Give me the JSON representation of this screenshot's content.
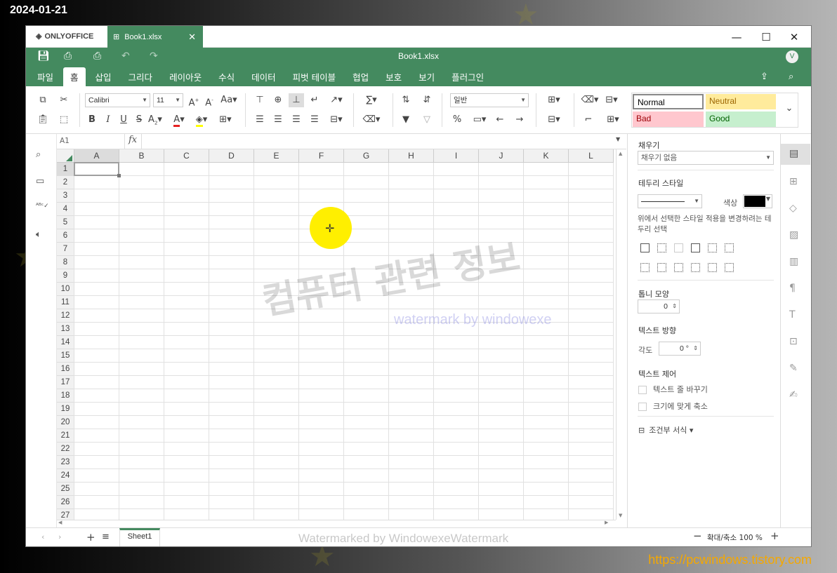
{
  "overlay": {
    "date": "2024-01-21",
    "site": "https://pcwindows.tistory.com"
  },
  "window": {
    "brand": "ONLYOFFICE",
    "tab_label": "Book1.xlsx",
    "title": "Book1.xlsx",
    "user_initial": "V",
    "controls": {
      "minimize": "—",
      "maximize": "☐",
      "close": "✕"
    }
  },
  "menu_tabs": [
    "파일",
    "홈",
    "삽입",
    "그리다",
    "레이아웃",
    "수식",
    "데이터",
    "피벗 테이블",
    "협업",
    "보호",
    "보기",
    "플러그인"
  ],
  "toolbar": {
    "font_name": "Calibri",
    "font_size": "11",
    "number_format": "일반",
    "styles": [
      {
        "label": "Normal",
        "bg": "#ffffff",
        "fg": "#000000"
      },
      {
        "label": "Neutral",
        "bg": "#ffeb9c",
        "fg": "#9c6500"
      },
      {
        "label": "Bad",
        "bg": "#ffc7ce",
        "fg": "#9c0006"
      },
      {
        "label": "Good",
        "bg": "#c6efce",
        "fg": "#006100"
      }
    ],
    "fx": "fx",
    "cell_ref": "A1",
    "font_color": "#e62222",
    "fill_color": "#ffff00"
  },
  "sheet": {
    "columns": [
      "A",
      "B",
      "C",
      "D",
      "E",
      "F",
      "G",
      "H",
      "I",
      "J",
      "K",
      "L"
    ],
    "rows": [
      "1",
      "2",
      "3",
      "4",
      "5",
      "6",
      "7",
      "8",
      "9",
      "10",
      "11",
      "12",
      "13",
      "14",
      "15",
      "16",
      "17",
      "18",
      "19",
      "20",
      "21",
      "22",
      "23",
      "24",
      "25",
      "26",
      "27"
    ],
    "selected_cell": "A1"
  },
  "panel": {
    "fill_title": "채우기",
    "fill_value": "채우기 없음",
    "border_style_title": "테두리 스타일",
    "color_label": "색상",
    "border_color": "#000000",
    "border_hint": "위에서 선택한 스타일 적용을 변경하려는 테두리 선택",
    "tooth_title": "톱니 모양",
    "tooth_value": "0",
    "text_dir_title": "텍스트 방향",
    "angle_label": "각도",
    "angle_value": "0 °",
    "text_ctrl_title": "텍스트 제어",
    "wrap_label": "텍스트 줄 바꾸기",
    "shrink_label": "크기에 맞게 축소",
    "cond_format_label": "조건부 서식"
  },
  "status": {
    "sheet_tab": "Sheet1",
    "zoom_label": "확대/축소 100 %"
  },
  "watermarks": {
    "main": "컴퓨터 관련 정보",
    "sub": "watermark by windowexe",
    "bottom": "Watermarked by WindowexeWatermark"
  },
  "colors": {
    "accent": "#448a5f",
    "highlight": "#ffef00"
  }
}
